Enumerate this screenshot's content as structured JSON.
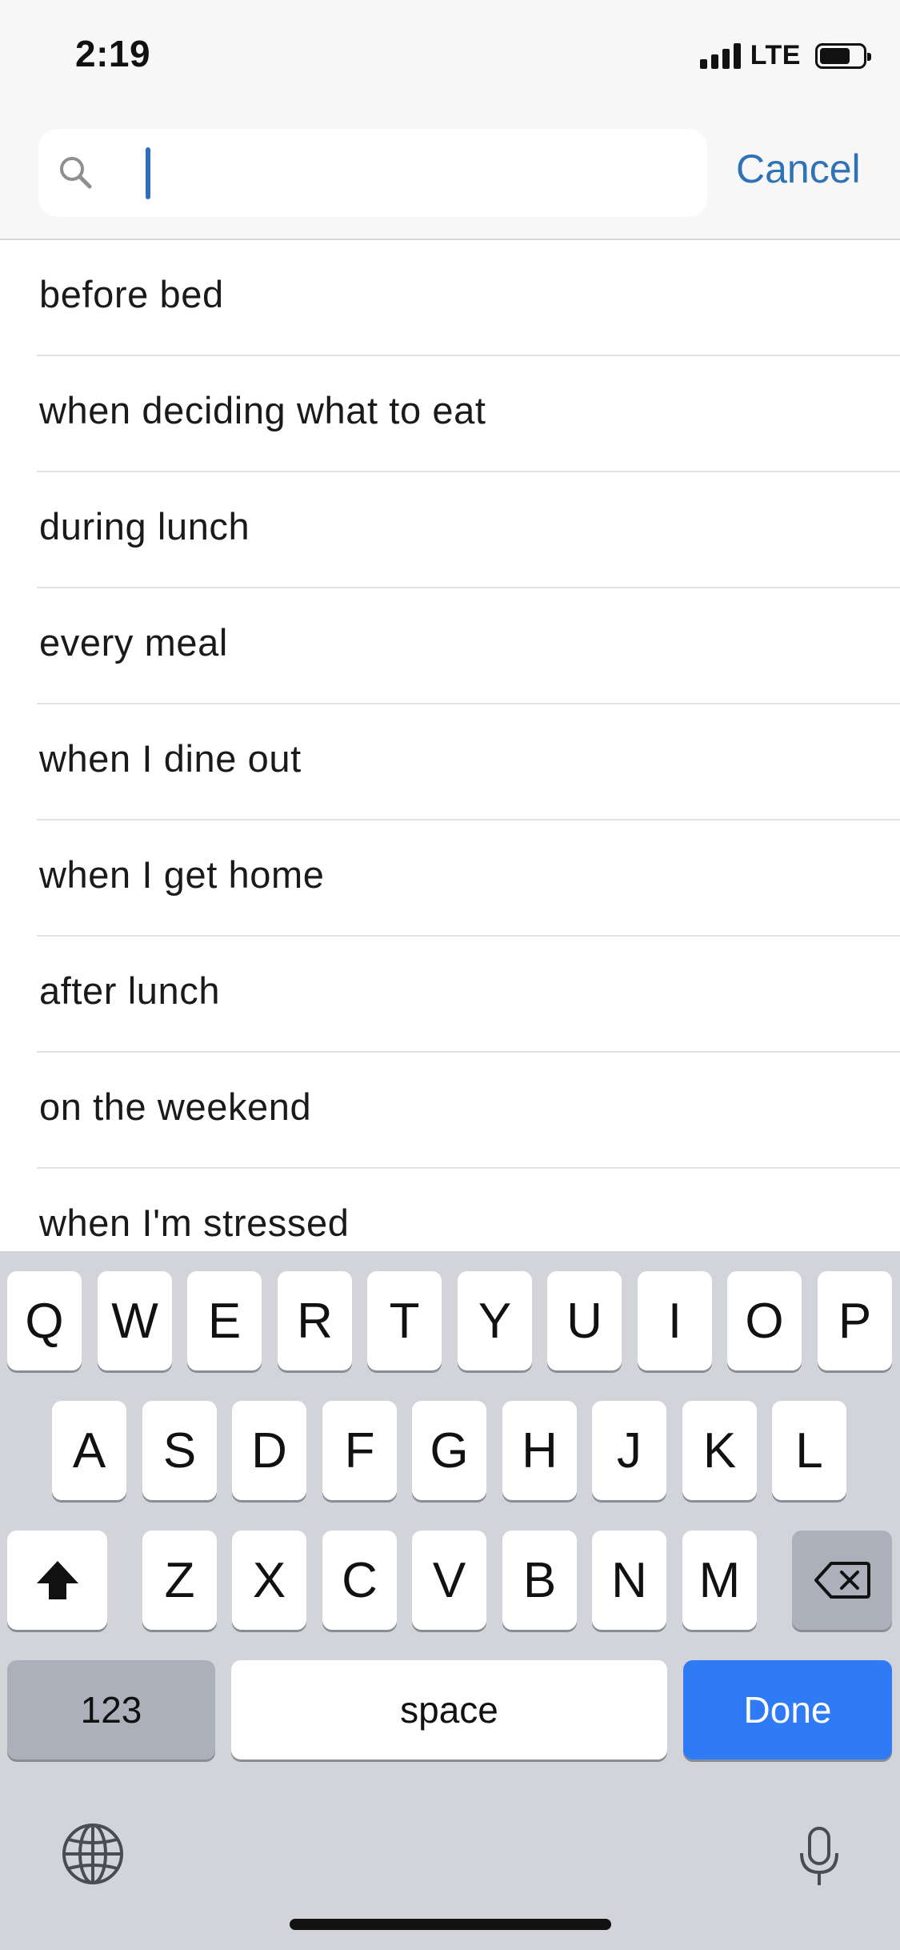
{
  "status_bar": {
    "time": "2:19",
    "network": "LTE"
  },
  "search": {
    "placeholder": "",
    "value": "",
    "cancel_label": "Cancel"
  },
  "suggestions": [
    "before bed",
    "when deciding what to eat",
    "during lunch",
    "every meal",
    "when I dine out",
    "when I get home",
    "after lunch",
    "on the weekend",
    "when I'm stressed"
  ],
  "keyboard": {
    "row1": [
      "Q",
      "W",
      "E",
      "R",
      "T",
      "Y",
      "U",
      "I",
      "O",
      "P"
    ],
    "row2": [
      "A",
      "S",
      "D",
      "F",
      "G",
      "H",
      "J",
      "K",
      "L"
    ],
    "row3": [
      "Z",
      "X",
      "C",
      "V",
      "B",
      "N",
      "M"
    ],
    "numbers_label": "123",
    "space_label": "space",
    "done_label": "Done"
  },
  "colors": {
    "accent": "#2f72b6",
    "done_key": "#2f7bf5",
    "keyboard_bg": "#d2d4da"
  },
  "icons": [
    "search-icon",
    "shift-icon",
    "delete-icon",
    "globe-icon",
    "microphone-icon"
  ]
}
